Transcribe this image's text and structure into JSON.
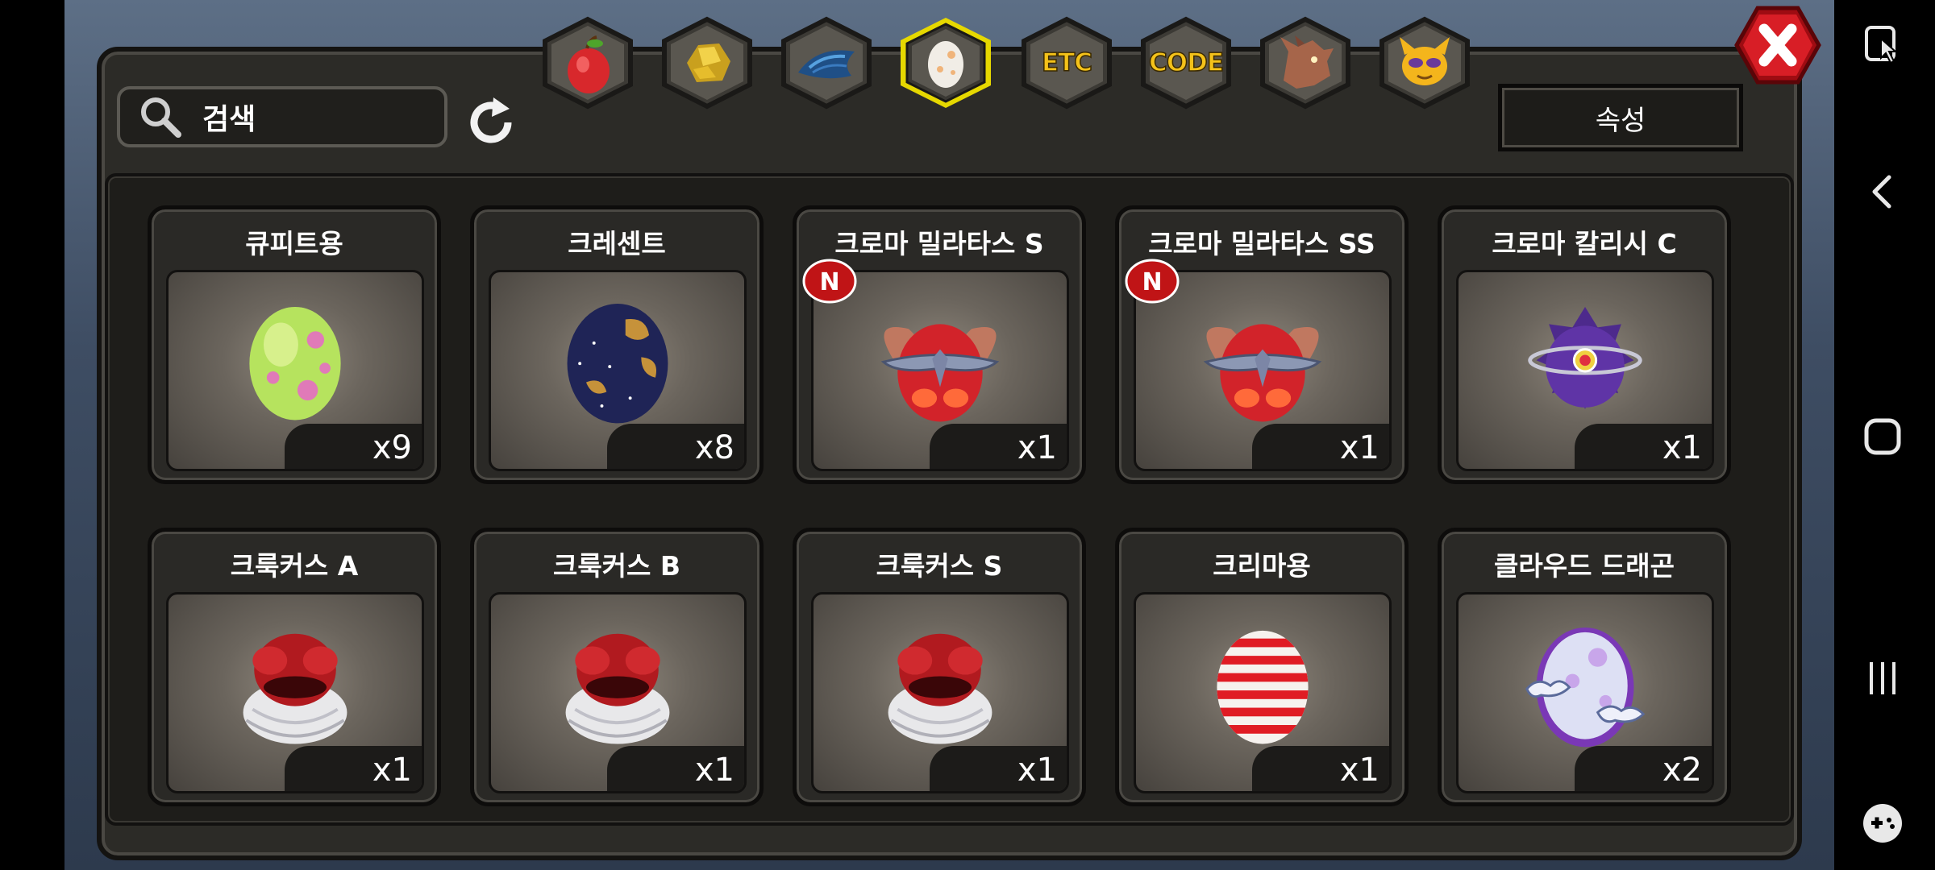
{
  "search": {
    "label": "검색"
  },
  "attribute_button": "속성",
  "tabs": [
    {
      "id": "fruit",
      "icon": "red-pear-icon"
    },
    {
      "id": "gold",
      "icon": "gold-ore-icon"
    },
    {
      "id": "scale",
      "icon": "blue-scale-icon"
    },
    {
      "id": "egg",
      "icon": "egg-icon",
      "selected": true
    },
    {
      "id": "etc",
      "text": "ETC"
    },
    {
      "id": "code",
      "text": "CODE"
    },
    {
      "id": "dragon",
      "icon": "dragon-head-icon"
    },
    {
      "id": "pet",
      "icon": "yellow-pet-icon"
    }
  ],
  "items": [
    {
      "name": "큐피트용",
      "count": "x9",
      "new": false,
      "egg": "green-spotted"
    },
    {
      "name": "크레센트",
      "count": "x8",
      "new": false,
      "egg": "navy-starry"
    },
    {
      "name": "크로마 밀라타스 S",
      "count": "x1",
      "new": true,
      "egg": "red-winged"
    },
    {
      "name": "크로마 밀라타스 SS",
      "count": "x1",
      "new": true,
      "egg": "red-winged"
    },
    {
      "name": "크로마 칼리시 C",
      "count": "x1",
      "new": false,
      "egg": "purple-ringed"
    },
    {
      "name": "크룩커스 A",
      "count": "x1",
      "new": false,
      "egg": "red-feathered"
    },
    {
      "name": "크룩커스 B",
      "count": "x1",
      "new": false,
      "egg": "red-feathered"
    },
    {
      "name": "크룩커스 S",
      "count": "x1",
      "new": false,
      "egg": "red-feathered"
    },
    {
      "name": "크리마용",
      "count": "x1",
      "new": false,
      "egg": "red-striped"
    },
    {
      "name": "클라우드 드래곤",
      "count": "x2",
      "new": false,
      "egg": "cloud"
    }
  ],
  "new_badge_text": "N",
  "nav": [
    "pointer-icon",
    "back-icon",
    "home-icon",
    "recents-icon",
    "gamepad-icon"
  ]
}
